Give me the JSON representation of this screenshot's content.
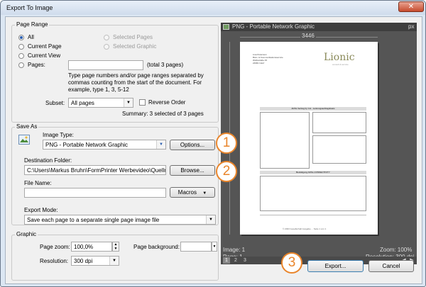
{
  "window": {
    "title": "Export To Image",
    "close": "✕"
  },
  "page_range": {
    "title": "Page Range",
    "options": [
      "All",
      "Current Page",
      "Current View",
      "Pages:"
    ],
    "disabled_options": [
      "Selected Pages",
      "Selected Graphic"
    ],
    "pages_value": "",
    "total": "(total 3 pages)",
    "hint": [
      "Type page numbers and/or page ranges separated by",
      "commas counting from the start of the document. For",
      "example, type 1, 3, 5-12"
    ],
    "subset_label": "Subset:",
    "subset_value": "All pages",
    "reverse_label": "Reverse Order",
    "summary": "Summary: 3 selected of 3 pages"
  },
  "save_as": {
    "title": "Save As",
    "image_type_label": "Image Type:",
    "image_type_value": "PNG - Portable Network Graphic",
    "options_button": "Options...",
    "dest_label": "Destination Folder:",
    "dest_value": "C:\\Users\\Markus Bruhn\\FormPrinter Werbevideo\\Quellm",
    "browse_button": "Browse...",
    "file_name_label": "File Name:",
    "file_name_value": "",
    "macros_button": "Macros",
    "export_mode_label": "Export Mode:",
    "export_mode_value": "Save each page to a separate single page image file"
  },
  "graphic": {
    "title": "Graphic",
    "zoom_label": "Page zoom:",
    "zoom_value": "100,0%",
    "background_label": "Page background:",
    "resolution_label": "Resolution:",
    "resolution_value": "300 dpi"
  },
  "preview": {
    "header": "PNG - Portable Network Graphic",
    "unit": "px",
    "width_px": "3446",
    "image_label": "Image: 1",
    "page_label": "Page: 1",
    "zoom": "Zoom: 100%",
    "resolution": "Resolution: 300 dpi",
    "page_tabs": [
      "1",
      "2",
      "3"
    ],
    "doc": {
      "sender": [
        "Lisa Petersson",
        "Büro- & Kommunikationsservice",
        "Wolfsstraße 45",
        "",
        "24981 Irdorf"
      ],
      "logo": "Lionic",
      "logo_sub": "consult & service",
      "heading": "ADSL Vertrag by Col - Leistungsauftragsbasis",
      "table_heading": "Bestätigung ADSL-CONNECTIVITY",
      "footer": "© 2003 Gesellschaft Ausgabe ... Seite 1 von 1"
    }
  },
  "callouts": [
    "1",
    "2",
    "3"
  ],
  "buttons": {
    "export": "Export...",
    "cancel": "Cancel"
  },
  "colors": {
    "accent": "#e9852b",
    "selection": "#2a5eb0"
  }
}
